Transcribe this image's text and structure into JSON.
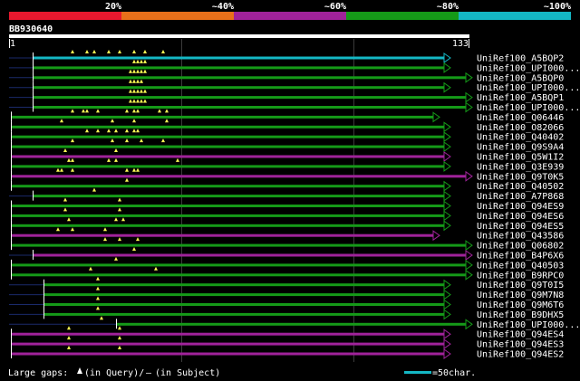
{
  "scale_bar": {
    "segments": [
      {
        "label": "20%",
        "color": "#e8182e"
      },
      {
        "label": "~40%",
        "color": "#e8701a"
      },
      {
        "label": "~60%",
        "color": "#a0229a"
      },
      {
        "label": "~80%",
        "color": "#159a18"
      },
      {
        "label": "~100%",
        "color": "#14b7c4"
      }
    ]
  },
  "query": {
    "id": "BB930640",
    "start": "1",
    "end": "133"
  },
  "hits": [
    {
      "name": "UniRef100_A5BQP2",
      "color": "#14b7c4"
    },
    {
      "name": "UniRef100_UPI000...",
      "color": "#159a18"
    },
    {
      "name": "UniRef100_A5BQP0",
      "color": "#159a18"
    },
    {
      "name": "UniRef100_UPI000...",
      "color": "#159a18"
    },
    {
      "name": "UniRef100_A5BQP1",
      "color": "#159a18"
    },
    {
      "name": "UniRef100_UPI000...",
      "color": "#159a18"
    },
    {
      "name": "UniRef100_Q06446",
      "color": "#159a18"
    },
    {
      "name": "UniRef100_O82066",
      "color": "#159a18"
    },
    {
      "name": "UniRef100_Q40402",
      "color": "#159a18"
    },
    {
      "name": "UniRef100_Q9S9A4",
      "color": "#159a18"
    },
    {
      "name": "UniRef100_Q5W1I2",
      "color": "#a0229a"
    },
    {
      "name": "UniRef100_Q3E939",
      "color": "#159a18"
    },
    {
      "name": "UniRef100_Q9T0K5",
      "color": "#a0229a"
    },
    {
      "name": "UniRef100_Q40502",
      "color": "#159a18"
    },
    {
      "name": "UniRef100_A7P868",
      "color": "#159a18"
    },
    {
      "name": "UniRef100_Q94ES9",
      "color": "#159a18"
    },
    {
      "name": "UniRef100_Q94ES6",
      "color": "#159a18"
    },
    {
      "name": "UniRef100_Q94ES5",
      "color": "#159a18"
    },
    {
      "name": "UniRef100_Q43586",
      "color": "#a0229a"
    },
    {
      "name": "UniRef100_Q06802",
      "color": "#159a18"
    },
    {
      "name": "UniRef100_B4P6X6",
      "color": "#a0229a"
    },
    {
      "name": "UniRef100_Q40503",
      "color": "#159a18"
    },
    {
      "name": "UniRef100_B9RPC0",
      "color": "#159a18"
    },
    {
      "name": "UniRef100_Q9T0I5",
      "color": "#159a18"
    },
    {
      "name": "UniRef100_Q9M7N8",
      "color": "#159a18"
    },
    {
      "name": "UniRef100_Q9M6T6",
      "color": "#159a18"
    },
    {
      "name": "UniRef100_B9DHX5",
      "color": "#159a18"
    },
    {
      "name": "UniRef100_UPI000...",
      "color": "#159a18"
    },
    {
      "name": "UniRef100_Q94ES4",
      "color": "#a0229a"
    },
    {
      "name": "UniRef100_Q94ES3",
      "color": "#a0229a"
    },
    {
      "name": "UniRef100_Q94ES2",
      "color": "#a0229a"
    }
  ],
  "footer": {
    "legend_prefix": "Large gaps:",
    "legend_query": "(in Query)/",
    "legend_dash": "–",
    "legend_subject": " (in Subject)",
    "scale_label": "=50char."
  }
}
